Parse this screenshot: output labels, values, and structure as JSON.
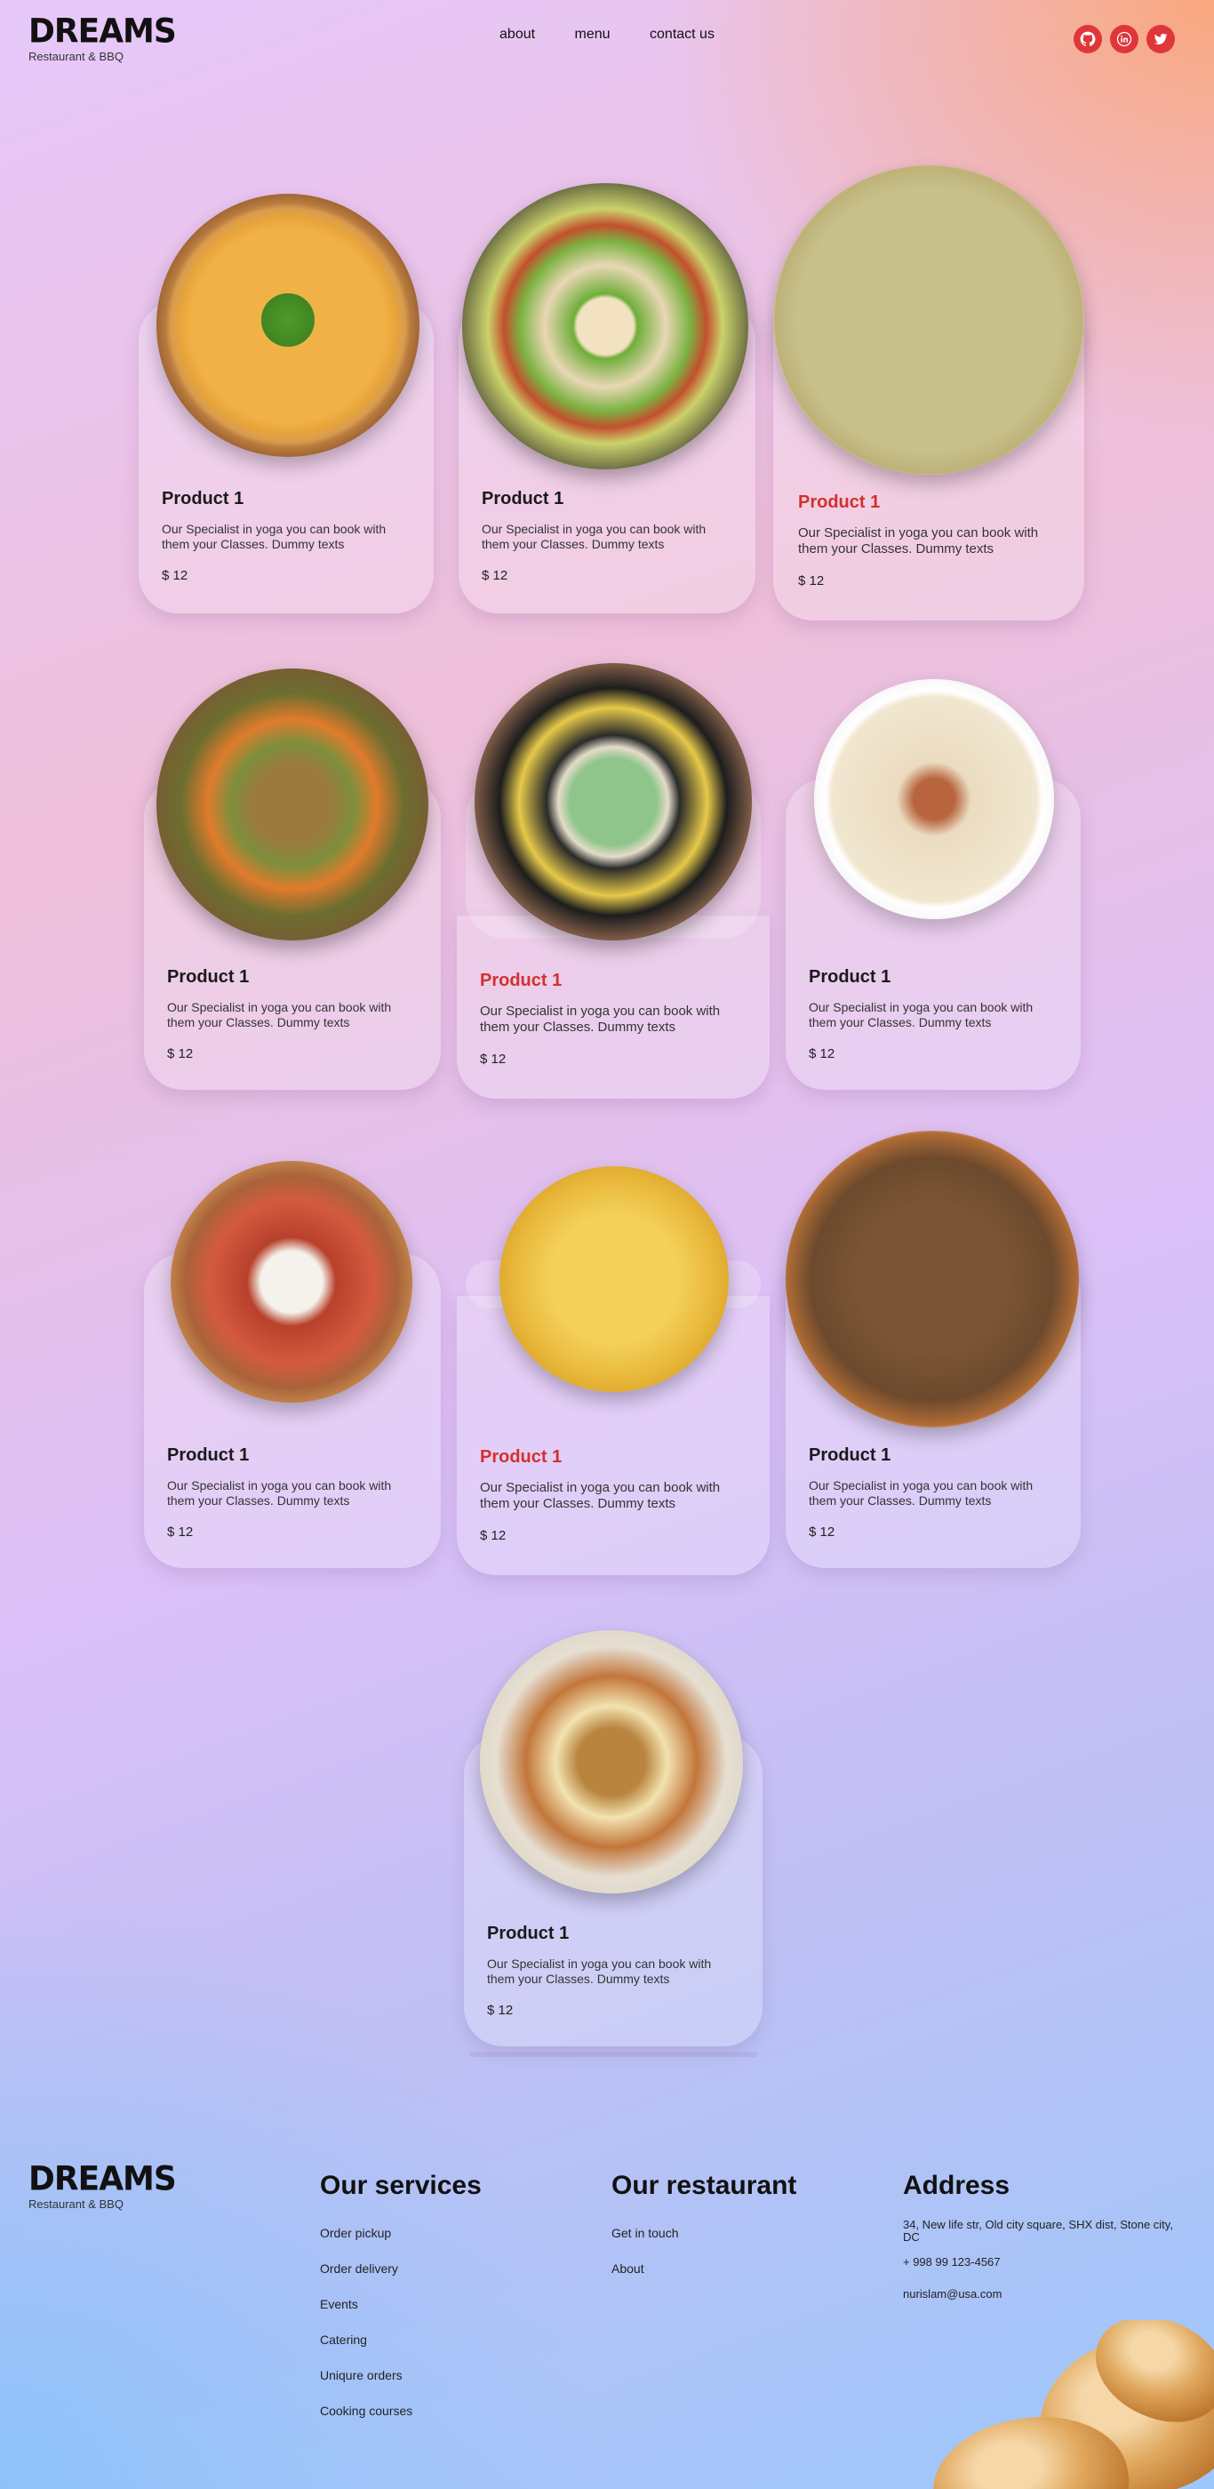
{
  "header": {
    "logo": "DREAMS",
    "tagline": "Restaurant & BBQ",
    "nav": [
      "about",
      "menu",
      "contact us"
    ],
    "socials": [
      "github-icon",
      "linkedin-icon",
      "twitter-icon"
    ]
  },
  "products": [
    {
      "name": "Product 1",
      "description": "Our Specialist in yoga you can book with them your Classes. Dummy texts",
      "price": "$ 12"
    },
    {
      "name": "Product 1",
      "description": "Our Specialist in yoga you can book with them your Classes. Dummy texts",
      "price": "$ 12"
    },
    {
      "name": "Product 1",
      "description": "Our Specialist in yoga you can book with them your Classes. Dummy texts",
      "price": "$ 12"
    },
    {
      "name": "Product 1",
      "description": "Our Specialist in yoga you can book with them your Classes. Dummy texts",
      "price": "$ 12"
    },
    {
      "name": "Product 1",
      "description": "Our Specialist in yoga you can book with them your Classes. Dummy texts",
      "price": "$ 12"
    },
    {
      "name": "Product 1",
      "description": "Our Specialist in yoga you can book with them your Classes. Dummy texts",
      "price": "$ 12"
    },
    {
      "name": "Product 1",
      "description": "Our Specialist in yoga you can book with them your Classes. Dummy texts",
      "price": "$ 12"
    },
    {
      "name": "Product 1",
      "description": "Our Specialist in yoga you can book with them your Classes. Dummy texts",
      "price": "$ 12"
    },
    {
      "name": "Product 1",
      "description": "Our Specialist in yoga you can book with them your Classes. Dummy texts",
      "price": "$ 12"
    },
    {
      "name": "Product 1",
      "description": "Our Specialist in yoga you can book with them your Classes. Dummy texts",
      "price": "$ 12"
    }
  ],
  "footer": {
    "logo": "DREAMS",
    "tagline": "Restaurant & BBQ",
    "services": {
      "title": "Our services",
      "items": [
        "Order pickup",
        "Order delivery",
        "Events",
        "Catering",
        "Uniqure orders",
        "Cooking courses"
      ]
    },
    "restaurant": {
      "title": "Our restaurant",
      "items": [
        "Get in touch",
        "About"
      ]
    },
    "address": {
      "title": "Address",
      "street": "34, New life str, Old city square, SHX dist, Stone city, DC",
      "phone": "+ 998 99 123-4567",
      "email": "nurislam@usa.com"
    }
  },
  "colors": {
    "accent": "#d3302e",
    "social": "#e0363a"
  }
}
